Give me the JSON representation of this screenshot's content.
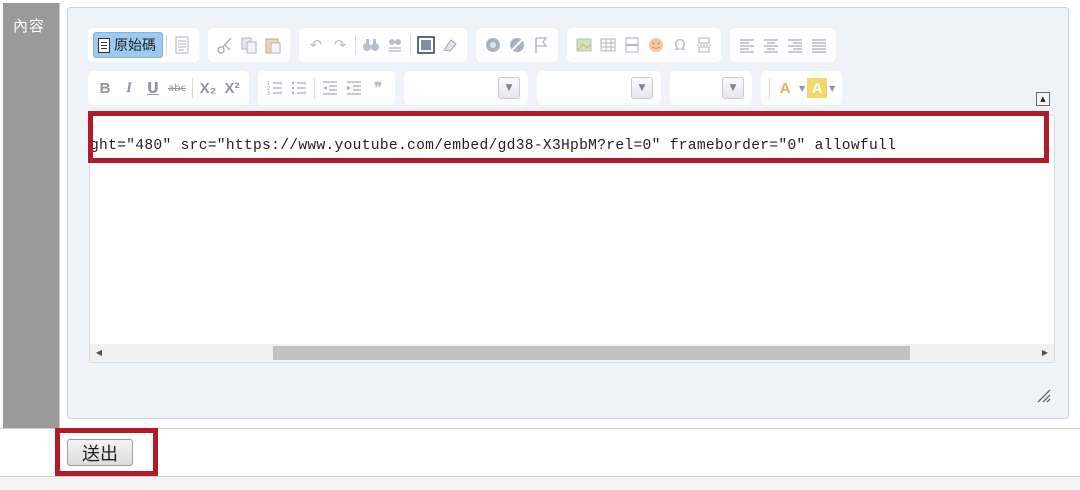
{
  "form": {
    "field_label": "內容",
    "submit_label": "送出"
  },
  "editor": {
    "source_button_label": "原始碼",
    "source_code": "ght=\"480\" src=\"https://www.youtube.com/embed/gd38-X3HpbM?rel=0\" frameborder=\"0\" allowfull",
    "collapse_glyph": "▲",
    "scroll_left_glyph": "◀",
    "scroll_right_glyph": "▶",
    "highlight_color": "#b21a2a",
    "toolbar_row1": [
      {
        "group": "document",
        "items": [
          "source-button",
          "preview-icon"
        ]
      },
      {
        "group": "clipboard",
        "items": [
          "cut-icon",
          "copy-icon",
          "paste-icon"
        ]
      },
      {
        "group": "undo",
        "items": [
          "undo-icon",
          "redo-icon",
          "find-icon",
          "replace-icon",
          "select-all-icon",
          "remove-format-icon"
        ]
      },
      {
        "group": "links",
        "items": [
          "link-icon",
          "unlink-icon",
          "anchor-icon"
        ]
      },
      {
        "group": "insert",
        "items": [
          "image-icon",
          "table-icon",
          "horizontal-rule-icon",
          "smiley-icon",
          "special-char-icon",
          "page-break-icon"
        ]
      },
      {
        "group": "align",
        "items": [
          "align-left-icon",
          "align-center-icon",
          "align-right-icon",
          "align-justify-icon"
        ]
      }
    ],
    "toolbar_row2": [
      {
        "group": "basic-styles",
        "items": [
          "bold-icon",
          "italic-icon",
          "underline-icon",
          "strike-icon",
          "subscript-icon",
          "superscript-icon"
        ]
      },
      {
        "group": "paragraph",
        "items": [
          "numbered-list-icon",
          "bulleted-list-icon",
          "outdent-icon",
          "indent-icon",
          "blockquote-icon"
        ]
      },
      {
        "group": "styles",
        "items": [
          "format-combo",
          "font-combo",
          "size-combo"
        ]
      },
      {
        "group": "colors",
        "items": [
          "text-color-icon",
          "background-color-icon"
        ]
      }
    ],
    "glyphs": {
      "bold": "B",
      "italic": "I",
      "underline": "U",
      "strike": "abc",
      "subscript": "X₂",
      "superscript": "X²",
      "blockquote": "❞",
      "special_char": "Ω",
      "undo": "↶",
      "redo": "↷",
      "text_color": "A",
      "bg_color": "A",
      "dropdown": "▼"
    }
  }
}
